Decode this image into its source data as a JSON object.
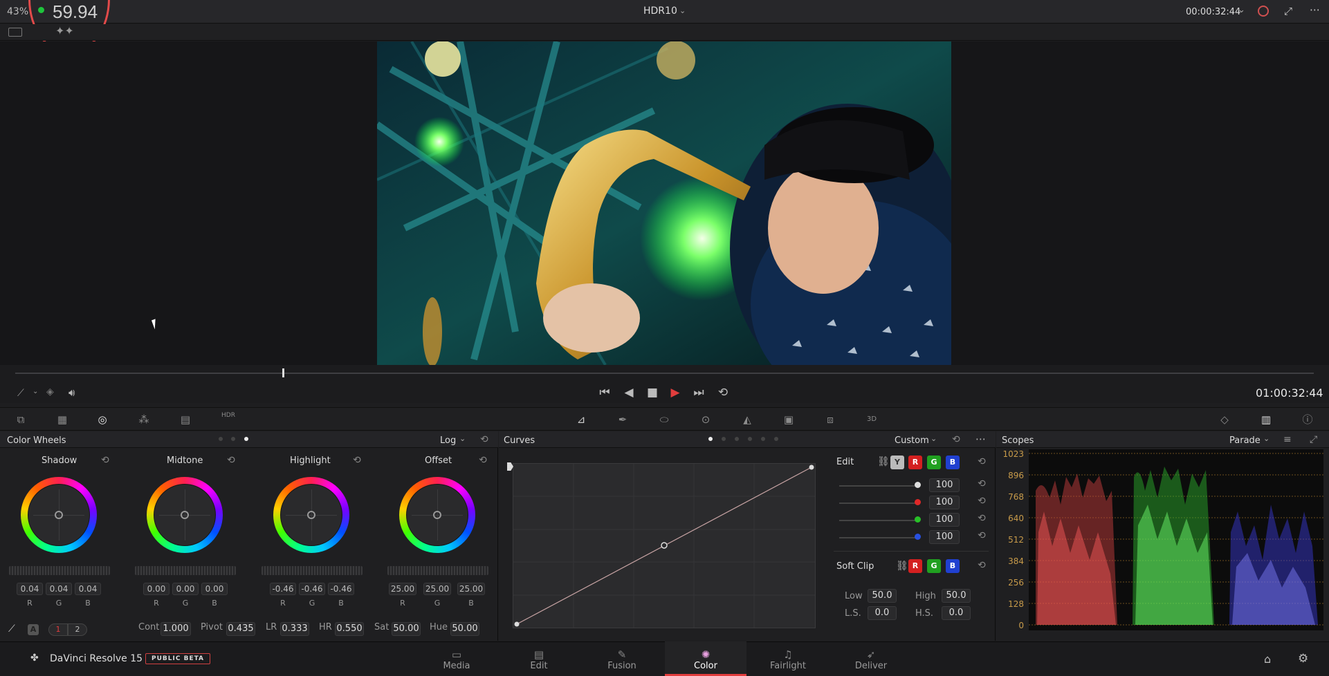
{
  "topbar": {
    "zoom": "43%",
    "fps": "59.94",
    "clip_title": "HDR10",
    "timecode": "00:00:32:44"
  },
  "transport": {
    "timecode": "01:00:32:44"
  },
  "toolbar": {
    "hdr_label": "HDR"
  },
  "wheels_panel": {
    "title": "Color Wheels",
    "mode": "Log",
    "wheels": [
      {
        "label": "Shadow",
        "r": "0.04",
        "g": "0.04",
        "b": "0.04"
      },
      {
        "label": "Midtone",
        "r": "0.00",
        "g": "0.00",
        "b": "0.00"
      },
      {
        "label": "Highlight",
        "r": "-0.46",
        "g": "-0.46",
        "b": "-0.46"
      },
      {
        "label": "Offset",
        "r": "25.00",
        "g": "25.00",
        "b": "25.00"
      }
    ],
    "ch_r": "R",
    "ch_g": "G",
    "ch_b": "B",
    "page1": "1",
    "page2": "2",
    "params": {
      "cont_label": "Cont",
      "cont": "1.000",
      "pivot_label": "Pivot",
      "pivot": "0.435",
      "lr_label": "LR",
      "lr": "0.333",
      "hr_label": "HR",
      "hr": "0.550",
      "sat_label": "Sat",
      "sat": "50.00",
      "hue_label": "Hue",
      "hue": "50.00"
    }
  },
  "curves_panel": {
    "title": "Curves",
    "mode": "Custom",
    "edit_label": "Edit",
    "sw_y": "Y",
    "sw_r": "R",
    "sw_g": "G",
    "sw_b": "B",
    "values": [
      "100",
      "100",
      "100",
      "100"
    ],
    "softclip_label": "Soft Clip",
    "low_label": "Low",
    "low": "50.0",
    "high_label": "High",
    "high": "50.0",
    "ls_label": "L.S.",
    "ls": "0.0",
    "hs_label": "H.S.",
    "hs": "0.0"
  },
  "scopes_panel": {
    "title": "Scopes",
    "mode": "Parade",
    "scale": [
      "1023",
      "896",
      "768",
      "640",
      "512",
      "384",
      "256",
      "128",
      "0"
    ]
  },
  "navbar": {
    "app_name": "DaVinci Resolve 15",
    "beta": "PUBLIC BETA",
    "items": [
      {
        "label": "Media"
      },
      {
        "label": "Edit"
      },
      {
        "label": "Fusion"
      },
      {
        "label": "Color"
      },
      {
        "label": "Fairlight"
      },
      {
        "label": "Deliver"
      }
    ]
  },
  "colors": {
    "accent": "#e23d3d",
    "status_dot": "#1ec53c",
    "scope_scale": "#c89b4a"
  }
}
